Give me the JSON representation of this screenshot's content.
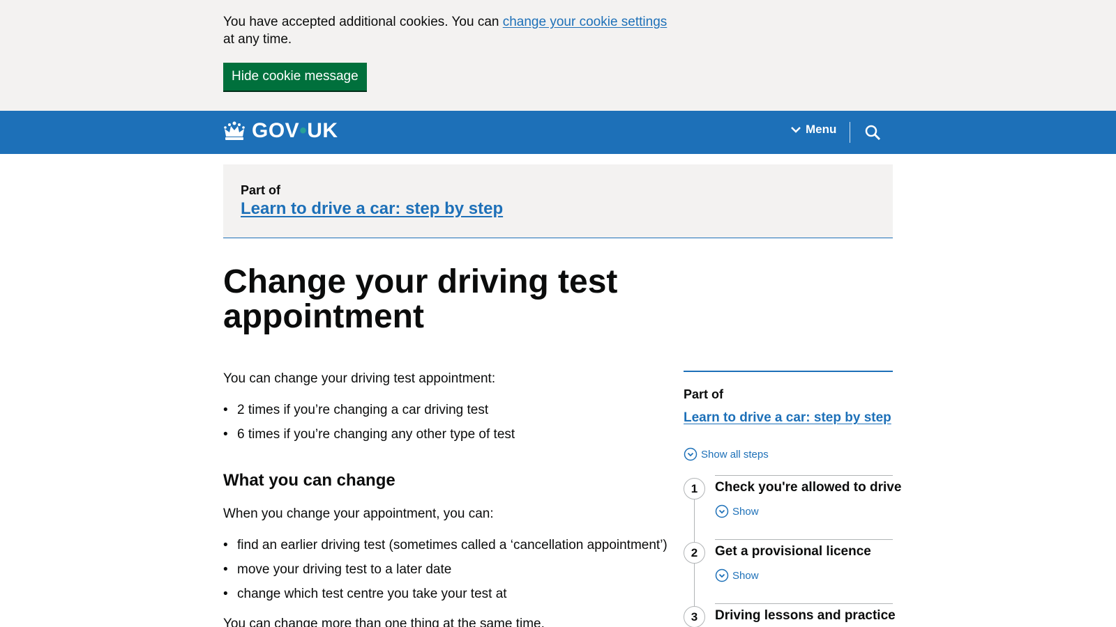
{
  "cookie_banner": {
    "text_before": "You have accepted additional cookies. You can ",
    "link_text": "change your cookie settings",
    "text_after": " at any time.",
    "hide_button": "Hide cookie message"
  },
  "header": {
    "logo_gov": "GOV",
    "logo_dot": "•",
    "logo_uk": "UK",
    "menu_label": "Menu",
    "search_icon": "search-icon",
    "crown_icon": "crown-icon"
  },
  "part_of_box": {
    "label": "Part of",
    "link": "Learn to drive a car: step by step"
  },
  "main": {
    "title": "Change your driving test appointment",
    "intro": "You can change your driving test appointment:",
    "intro_bullets": [
      "2 times if you’re changing a car driving test",
      "6 times if you’re changing any other type of test"
    ],
    "section_heading": "What you can change",
    "section_intro": "When you change your appointment, you can:",
    "section_bullets": [
      "find an earlier driving test (sometimes called a ‘cancellation appointment’)",
      "move your driving test to a later date",
      "change which test centre you take your test at"
    ],
    "footer_text": "You can change more than one thing at the same time."
  },
  "sidebar": {
    "label": "Part of",
    "link": "Learn to drive a car: step by step",
    "show_all": "Show all steps",
    "steps": [
      {
        "number": "1",
        "title": "Check you're allowed to drive",
        "show": "Show"
      },
      {
        "number": "2",
        "title": "Get a provisional licence",
        "show": "Show"
      },
      {
        "number": "3",
        "title": "Driving lessons and practice"
      }
    ]
  },
  "colors": {
    "brand_blue": "#1d70b8",
    "button_green": "#00703c",
    "light_grey": "#f3f2f1",
    "text": "#0b0c0c"
  }
}
